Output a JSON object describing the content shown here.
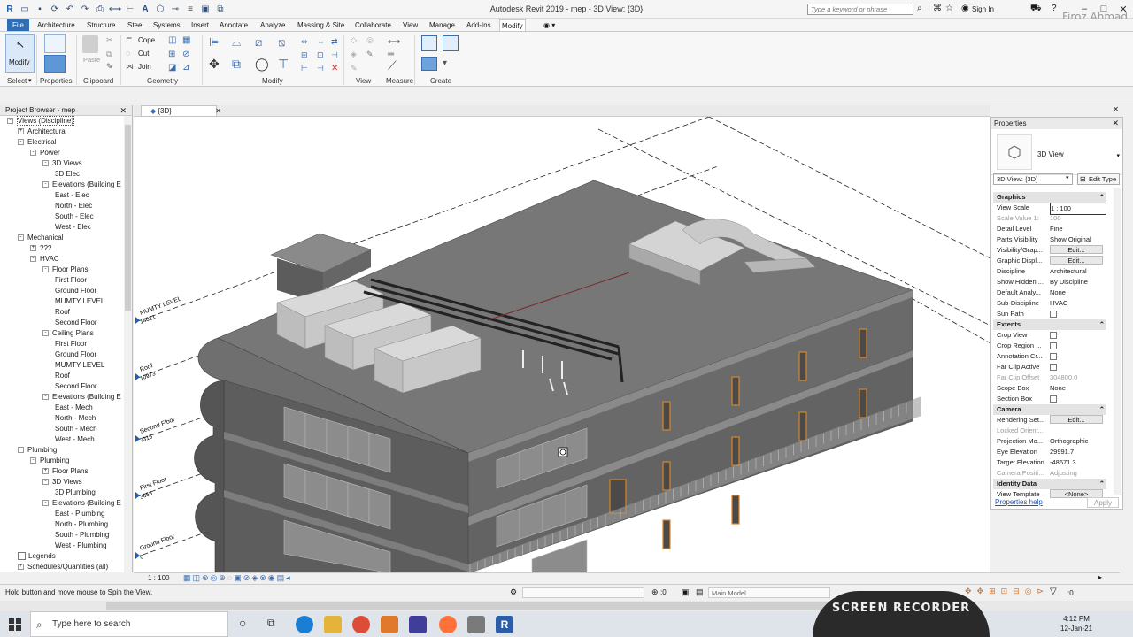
{
  "titlebar": {
    "app_title": "Autodesk Revit 2019 - mep - 3D View: {3D}",
    "search_placeholder": "Type a keyword or phrase",
    "sign_in": "Sign In",
    "watermark": "Firoz Ahmad"
  },
  "menu": {
    "tabs": [
      "File",
      "Architecture",
      "Structure",
      "Steel",
      "Systems",
      "Insert",
      "Annotate",
      "Analyze",
      "Massing & Site",
      "Collaborate",
      "View",
      "Manage",
      "Add-Ins",
      "Modify"
    ],
    "active": "Modify"
  },
  "ribbon": {
    "modify_label": "Modify",
    "panels": {
      "select": "Select",
      "properties": "Properties",
      "clipboard": "Clipboard",
      "geometry": "Geometry",
      "modify": "Modify",
      "view": "View",
      "measure": "Measure",
      "create": "Create"
    },
    "clipboard_paste": "Paste",
    "geometry_cope": "Cope",
    "geometry_cut": "Cut",
    "geometry_join": "Join"
  },
  "browser": {
    "title": "Project Browser - mep",
    "nodes": [
      {
        "label": "Views (Discipline)",
        "level": 0,
        "toggle": "-"
      },
      {
        "label": "Architectural",
        "level": 1,
        "toggle": "+"
      },
      {
        "label": "Electrical",
        "level": 1,
        "toggle": "-"
      },
      {
        "label": "Power",
        "level": 2,
        "toggle": "-"
      },
      {
        "label": "3D Views",
        "level": 3,
        "toggle": "-"
      },
      {
        "label": "3D Elec",
        "level": 4,
        "toggle": ""
      },
      {
        "label": "Elevations (Building E",
        "level": 3,
        "toggle": "-"
      },
      {
        "label": "East - Elec",
        "level": 4,
        "toggle": ""
      },
      {
        "label": "North - Elec",
        "level": 4,
        "toggle": ""
      },
      {
        "label": "South - Elec",
        "level": 4,
        "toggle": ""
      },
      {
        "label": "West - Elec",
        "level": 4,
        "toggle": ""
      },
      {
        "label": "Mechanical",
        "level": 1,
        "toggle": "-"
      },
      {
        "label": "???",
        "level": 2,
        "toggle": "+"
      },
      {
        "label": "HVAC",
        "level": 2,
        "toggle": "-"
      },
      {
        "label": "Floor Plans",
        "level": 3,
        "toggle": "-"
      },
      {
        "label": "First Floor",
        "level": 4,
        "toggle": ""
      },
      {
        "label": "Ground Floor",
        "level": 4,
        "toggle": ""
      },
      {
        "label": "MUMTY LEVEL",
        "level": 4,
        "toggle": ""
      },
      {
        "label": "Roof",
        "level": 4,
        "toggle": ""
      },
      {
        "label": "Second Floor",
        "level": 4,
        "toggle": ""
      },
      {
        "label": "Ceiling Plans",
        "level": 3,
        "toggle": "-"
      },
      {
        "label": "First Floor",
        "level": 4,
        "toggle": ""
      },
      {
        "label": "Ground Floor",
        "level": 4,
        "toggle": ""
      },
      {
        "label": "MUMTY LEVEL",
        "level": 4,
        "toggle": ""
      },
      {
        "label": "Roof",
        "level": 4,
        "toggle": ""
      },
      {
        "label": "Second Floor",
        "level": 4,
        "toggle": ""
      },
      {
        "label": "Elevations (Building E",
        "level": 3,
        "toggle": "-"
      },
      {
        "label": "East - Mech",
        "level": 4,
        "toggle": ""
      },
      {
        "label": "North - Mech",
        "level": 4,
        "toggle": ""
      },
      {
        "label": "South - Mech",
        "level": 4,
        "toggle": ""
      },
      {
        "label": "West - Mech",
        "level": 4,
        "toggle": ""
      },
      {
        "label": "Plumbing",
        "level": 1,
        "toggle": "-"
      },
      {
        "label": "Plumbing",
        "level": 2,
        "toggle": "-"
      },
      {
        "label": "Floor Plans",
        "level": 3,
        "toggle": "+"
      },
      {
        "label": "3D Views",
        "level": 3,
        "toggle": "-"
      },
      {
        "label": "3D Plumbing",
        "level": 4,
        "toggle": ""
      },
      {
        "label": "Elevations (Building E",
        "level": 3,
        "toggle": "-"
      },
      {
        "label": "East - Plumbing",
        "level": 4,
        "toggle": ""
      },
      {
        "label": "North - Plumbing",
        "level": 4,
        "toggle": ""
      },
      {
        "label": "South - Plumbing",
        "level": 4,
        "toggle": ""
      },
      {
        "label": "West - Plumbing",
        "level": 4,
        "toggle": ""
      },
      {
        "label": "Legends",
        "level": 1,
        "toggle": ""
      },
      {
        "label": "Schedules/Quantities (all)",
        "level": 1,
        "toggle": "+"
      }
    ]
  },
  "view": {
    "tab_label": "{3D}",
    "scale": "1 : 100",
    "levels": [
      {
        "name": "MUMTY LEVEL",
        "elev": "14021"
      },
      {
        "name": "Roof",
        "elev": "10973"
      },
      {
        "name": "Second Floor",
        "elev": "7315"
      },
      {
        "name": "First Floor",
        "elev": "3658"
      },
      {
        "name": "Ground Floor",
        "elev": "0"
      }
    ]
  },
  "properties": {
    "title": "Properties",
    "type_name": "3D View",
    "selector": "3D View: {3D}",
    "edit_type": "Edit Type",
    "rows": [
      {
        "kind": "group",
        "label": "Graphics"
      },
      {
        "label": "View Scale",
        "value": "1 : 100",
        "boxed": true
      },
      {
        "label": "Scale Value    1:",
        "value": "100",
        "dim": true
      },
      {
        "label": "Detail Level",
        "value": "Fine"
      },
      {
        "label": "Parts Visibility",
        "value": "Show Original"
      },
      {
        "label": "Visibility/Grap...",
        "value": "Edit...",
        "button": true
      },
      {
        "label": "Graphic Displ...",
        "value": "Edit...",
        "button": true
      },
      {
        "label": "Discipline",
        "value": "Architectural"
      },
      {
        "label": "Show Hidden ...",
        "value": "By Discipline"
      },
      {
        "label": "Default Analy...",
        "value": "None"
      },
      {
        "label": "Sub-Discipline",
        "value": "HVAC"
      },
      {
        "label": "Sun Path",
        "value": "",
        "check": true
      },
      {
        "kind": "group",
        "label": "Extents"
      },
      {
        "label": "Crop View",
        "value": "",
        "check": true
      },
      {
        "label": "Crop Region ...",
        "value": "",
        "check": true
      },
      {
        "label": "Annotation Cr...",
        "value": "",
        "check": true
      },
      {
        "label": "Far Clip Active",
        "value": "",
        "check": true
      },
      {
        "label": "Far Clip Offset",
        "value": "304800.0",
        "dim": true
      },
      {
        "label": "Scope Box",
        "value": "None"
      },
      {
        "label": "Section Box",
        "value": "",
        "check": true
      },
      {
        "kind": "group",
        "label": "Camera"
      },
      {
        "label": "Rendering Set...",
        "value": "Edit...",
        "button": true
      },
      {
        "label": "Locked Orient...",
        "value": "",
        "dim": true
      },
      {
        "label": "Projection Mo...",
        "value": "Orthographic"
      },
      {
        "label": "Eye Elevation",
        "value": "29991.7"
      },
      {
        "label": "Target Elevation",
        "value": "-48671.3"
      },
      {
        "label": "Camera Positi...",
        "value": "Adjusting",
        "dim": true
      },
      {
        "kind": "group",
        "label": "Identity Data"
      },
      {
        "label": "View Template",
        "value": "<None>",
        "button": true
      }
    ],
    "help": "Properties help",
    "apply": "Apply"
  },
  "status": {
    "message": "Hold button and move mouse to Spin the View.",
    "workset_count": ":0",
    "model": "Main Model",
    "filter_count": ":0"
  },
  "taskbar": {
    "search_placeholder": "Type here to search",
    "time": "4:12 PM",
    "date": "12-Jan-21"
  },
  "overlay": {
    "recorder_label": "SCREEN RECORDER"
  }
}
